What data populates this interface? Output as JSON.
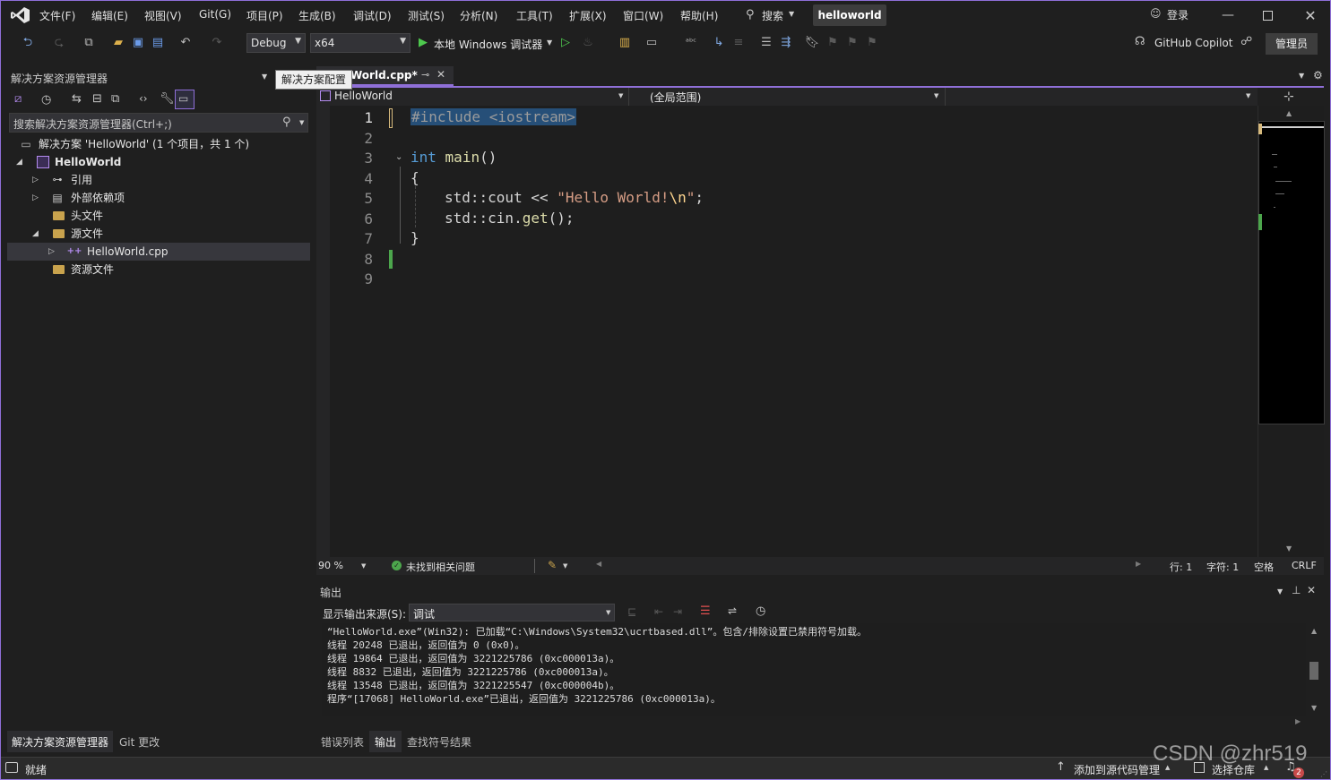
{
  "title_bar": {
    "menus": [
      "文件(F)",
      "编辑(E)",
      "视图(V)",
      "Git(G)",
      "项目(P)",
      "生成(B)",
      "调试(D)",
      "测试(S)",
      "分析(N)",
      "工具(T)",
      "扩展(X)",
      "窗口(W)",
      "帮助(H)"
    ],
    "search_label": "搜索",
    "solution_name": "helloworld",
    "login_label": "登录"
  },
  "toolbar": {
    "config": "Debug",
    "platform": "x64",
    "run_label": "本地 Windows 调试器",
    "copilot_label": "GitHub Copilot",
    "admin_label": "管理员"
  },
  "solution_explorer": {
    "title": "解决方案资源管理器",
    "tooltip": "解决方案配置",
    "search_placeholder": "搜索解决方案资源管理器(Ctrl+;)",
    "items": [
      {
        "label": "解决方案 'HelloWorld' (1 个项目，共 1 个)",
        "icon": "solution-icon"
      },
      {
        "label": "HelloWorld",
        "icon": "project-icon"
      },
      {
        "label": "引用",
        "icon": "references-icon"
      },
      {
        "label": "外部依赖项",
        "icon": "external-deps-icon"
      },
      {
        "label": "头文件",
        "icon": "folder-filter-icon"
      },
      {
        "label": "源文件",
        "icon": "folder-filter-icon"
      },
      {
        "label": "HelloWorld.cpp",
        "icon": "cpp-file-icon"
      },
      {
        "label": "资源文件",
        "icon": "folder-filter-icon"
      }
    ],
    "bottom_tabs": [
      "解决方案资源管理器",
      "Git 更改"
    ]
  },
  "editor": {
    "tab_label": "World.cpp*",
    "nav_project": "HelloWorld",
    "nav_scope": "(全局范围)",
    "line_numbers": [
      "1",
      "2",
      "3",
      "4",
      "5",
      "6",
      "7",
      "8",
      "9"
    ],
    "code": {
      "l1": "#include <iostream>",
      "l3_kw": "int",
      "l3_fn": "main",
      "l3_rest": "()",
      "l4": "{",
      "l5_a": "std::cout << ",
      "l5_str1": "\"Hello World!",
      "l5_esc": "\\n",
      "l5_str2": "\"",
      "l5_end": ";",
      "l6_a": "std::cin.",
      "l6_fn": "get",
      "l6_b": "();",
      "l7": "}"
    },
    "zoom": "90 %",
    "status_issues": "未找到相关问题",
    "row": "行: 1",
    "col": "字符: 1",
    "spacing": "空格",
    "eol": "CRLF"
  },
  "output": {
    "title": "输出",
    "source_label": "显示输出来源(S):",
    "source_value": "调试",
    "lines": [
      "“HelloWorld.exe”(Win32): 已加载“C:\\Windows\\System32\\ucrtbased.dll”。包含/排除设置已禁用符号加载。",
      "线程 20248 已退出，返回值为 0 (0x0)。",
      "线程 19864 已退出，返回值为 3221225786 (0xc000013a)。",
      "线程 8832 已退出，返回值为 3221225786 (0xc000013a)。",
      "线程 13548 已退出，返回值为 3221225547 (0xc000004b)。",
      "程序“[17068] HelloWorld.exe”已退出，返回值为 3221225786 (0xc000013a)。"
    ],
    "bottom_tabs": [
      "错误列表",
      "输出",
      "查找符号结果"
    ]
  },
  "status_bar": {
    "ready": "就绪",
    "add_source_control": "添加到源代码管理",
    "select_repo": "选择仓库",
    "notifications": "2"
  },
  "watermark": "CSDN @zhr519",
  "colors": {
    "accent": "#8f6fd8",
    "background": "#1f1f1f",
    "keyword": "#569cd6",
    "string": "#d69d85",
    "function": "#dcdcaa",
    "added_line": "#4ca64c",
    "selection": "#264f78"
  }
}
